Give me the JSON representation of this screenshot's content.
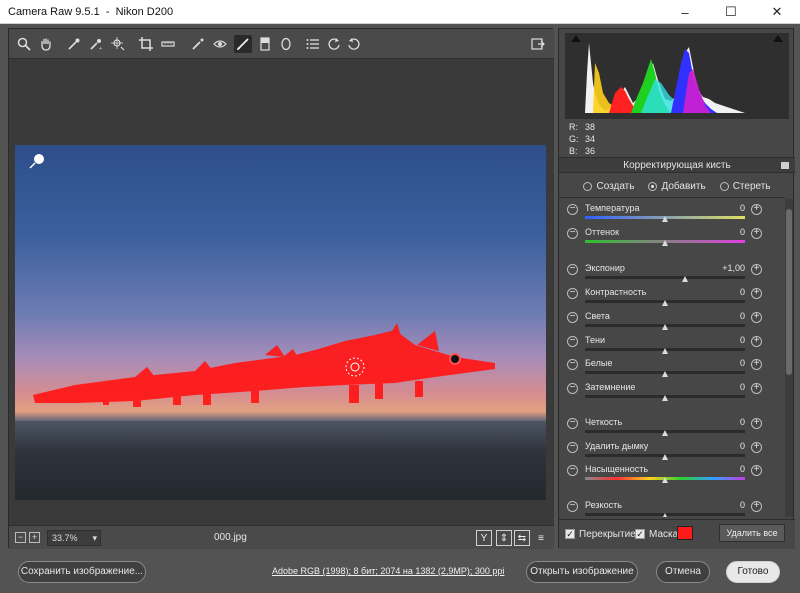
{
  "window": {
    "title": "Camera Raw 9.5.1  -  Nikon D200",
    "minimize": "–",
    "maximize": "☐",
    "close": "✕"
  },
  "toolbar": {
    "tools": [
      "zoom-icon",
      "hand-icon",
      "white-balance-icon",
      "color-sampler-icon",
      "target-adjust-icon",
      "crop-icon",
      "straighten-icon",
      "spot-removal-icon",
      "red-eye-icon",
      "adjustment-brush-icon",
      "graduated-filter-icon",
      "radial-filter-icon",
      "preferences-icon",
      "rotate-left-icon",
      "rotate-right-icon"
    ],
    "active_tool": "adjustment-brush-icon",
    "fullscreen_icon": "fullscreen-icon"
  },
  "status": {
    "zoom_out": "−",
    "zoom_in": "+",
    "zoom": "33.7%",
    "zoom_chevron": "▾",
    "filename": "000.jpg",
    "view_y": "Y",
    "view_compare": "⇕",
    "view_swap": "⇆",
    "view_settings": "≡"
  },
  "histogram": {
    "r_label": "R:",
    "g_label": "G:",
    "b_label": "B:",
    "r": "38",
    "g": "34",
    "b": "36"
  },
  "panel": {
    "title": "Корректирующая кисть",
    "modes": [
      "Создать",
      "Добавить",
      "Стереть"
    ],
    "selected_mode": "Добавить"
  },
  "sliders": [
    {
      "label": "Температура",
      "value": "0",
      "pos": 0.5,
      "track": "temp"
    },
    {
      "label": "Оттенок",
      "value": "0",
      "pos": 0.5,
      "track": "tint"
    },
    {
      "label": "Экспонир",
      "value": "+1,00",
      "pos": 0.625,
      "track": "plain"
    },
    {
      "label": "Контрастность",
      "value": "0",
      "pos": 0.5,
      "track": "plain"
    },
    {
      "label": "Света",
      "value": "0",
      "pos": 0.5,
      "track": "plain"
    },
    {
      "label": "Тени",
      "value": "0",
      "pos": 0.5,
      "track": "plain"
    },
    {
      "label": "Белые",
      "value": "0",
      "pos": 0.5,
      "track": "plain"
    },
    {
      "label": "Затемнение",
      "value": "0",
      "pos": 0.5,
      "track": "plain"
    },
    {
      "label": "Четкость",
      "value": "0",
      "pos": 0.5,
      "track": "plain"
    },
    {
      "label": "Удалить дымку",
      "value": "0",
      "pos": 0.5,
      "track": "plain"
    },
    {
      "label": "Насыщенность",
      "value": "0",
      "pos": 0.5,
      "track": "sat"
    },
    {
      "label": "Резкость",
      "value": "0",
      "pos": 0.5,
      "track": "plain"
    }
  ],
  "overlay": {
    "overlay_label": "Перекрытие",
    "mask_label": "Маска",
    "mask_color": "#ff1a1a",
    "check": "✓",
    "delete_all": "Удалить все"
  },
  "footer": {
    "save": "Сохранить изображение...",
    "info_link": "Adobe RGB (1998); 8 бит; 2074 на 1382 (2,9MP); 300 ppi",
    "open": "Открыть изображение",
    "cancel": "Отмена",
    "done": "Готово"
  },
  "colors": {
    "accent_mask": "#ff1a1a",
    "panel_bg": "#474747",
    "window_bg": "#535353"
  }
}
